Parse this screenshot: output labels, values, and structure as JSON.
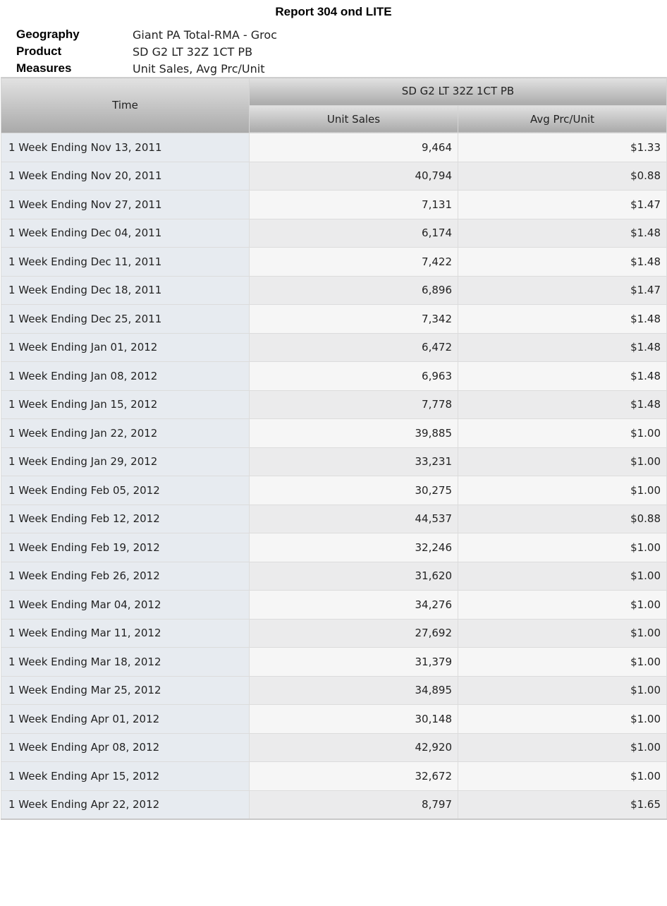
{
  "title": "Report 304 ond LITE",
  "meta": [
    {
      "label": "Geography",
      "value": "Giant PA Total-RMA - Groc"
    },
    {
      "label": "Product",
      "value": "SD G2 LT 32Z 1CT PB"
    },
    {
      "label": "Measures",
      "value": "Unit Sales, Avg Prc/Unit"
    }
  ],
  "table": {
    "time_header": "Time",
    "product_header": "SD G2 LT 32Z 1CT PB",
    "col_headers": [
      "Unit Sales",
      "Avg Prc/Unit"
    ],
    "rows": [
      [
        "1 Week Ending Nov 13, 2011",
        "9,464",
        "$1.33"
      ],
      [
        "1 Week Ending Nov 20, 2011",
        "40,794",
        "$0.88"
      ],
      [
        "1 Week Ending Nov 27, 2011",
        "7,131",
        "$1.47"
      ],
      [
        "1 Week Ending Dec 04, 2011",
        "6,174",
        "$1.48"
      ],
      [
        "1 Week Ending Dec 11, 2011",
        "7,422",
        "$1.48"
      ],
      [
        "1 Week Ending Dec 18, 2011",
        "6,896",
        "$1.47"
      ],
      [
        "1 Week Ending Dec 25, 2011",
        "7,342",
        "$1.48"
      ],
      [
        "1 Week Ending Jan 01, 2012",
        "6,472",
        "$1.48"
      ],
      [
        "1 Week Ending Jan 08, 2012",
        "6,963",
        "$1.48"
      ],
      [
        "1 Week Ending Jan 15, 2012",
        "7,778",
        "$1.48"
      ],
      [
        "1 Week Ending Jan 22, 2012",
        "39,885",
        "$1.00"
      ],
      [
        "1 Week Ending Jan 29, 2012",
        "33,231",
        "$1.00"
      ],
      [
        "1 Week Ending Feb 05, 2012",
        "30,275",
        "$1.00"
      ],
      [
        "1 Week Ending Feb 12, 2012",
        "44,537",
        "$0.88"
      ],
      [
        "1 Week Ending Feb 19, 2012",
        "32,246",
        "$1.00"
      ],
      [
        "1 Week Ending Feb 26, 2012",
        "31,620",
        "$1.00"
      ],
      [
        "1 Week Ending Mar 04, 2012",
        "34,276",
        "$1.00"
      ],
      [
        "1 Week Ending Mar 11, 2012",
        "27,692",
        "$1.00"
      ],
      [
        "1 Week Ending Mar 18, 2012",
        "31,379",
        "$1.00"
      ],
      [
        "1 Week Ending Mar 25, 2012",
        "34,895",
        "$1.00"
      ],
      [
        "1 Week Ending Apr 01, 2012",
        "30,148",
        "$1.00"
      ],
      [
        "1 Week Ending Apr 08, 2012",
        "42,920",
        "$1.00"
      ],
      [
        "1 Week Ending Apr 15, 2012",
        "32,672",
        "$1.00"
      ],
      [
        "1 Week Ending Apr 22, 2012",
        "8,797",
        "$1.65"
      ]
    ]
  }
}
